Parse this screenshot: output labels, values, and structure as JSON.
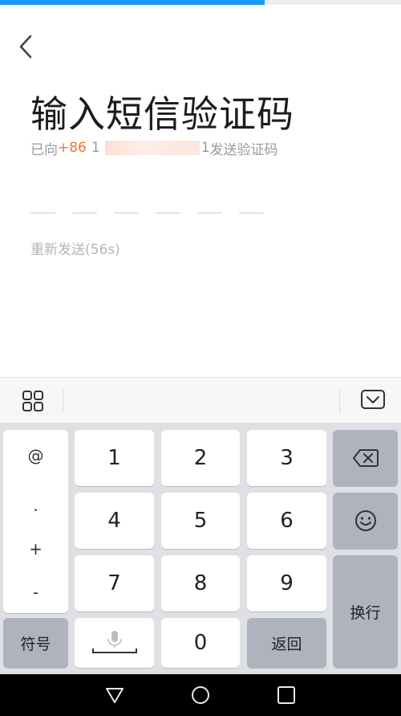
{
  "progress": {
    "fraction": 0.66,
    "color": "#1a9af2"
  },
  "header": {
    "back_icon": "chevron-left-icon"
  },
  "page": {
    "title": "输入短信验证码",
    "hint_prefix": "已向",
    "country_code": "+86",
    "phone_partial": "1",
    "phone_tail": "1",
    "hint_suffix": "发送验证码",
    "resend_label": "重新发送(56s)",
    "code_length": 6
  },
  "keyboard_toolbar": {
    "menu_icon": "grid-icon",
    "hide_icon": "keyboard-hide-icon"
  },
  "keyboard": {
    "symbols": [
      "@",
      ".",
      "+",
      "-"
    ],
    "digits": [
      "1",
      "2",
      "3",
      "4",
      "5",
      "6",
      "7",
      "8",
      "9",
      "0"
    ],
    "symbols_key": "符号",
    "return_key": "返回",
    "newline_key": "换行",
    "delete_icon": "backspace-icon",
    "emoji_icon": "smiley-icon",
    "voice_icon": "microphone-icon"
  },
  "navbar": {
    "back_icon": "triangle-back-icon",
    "home_icon": "circle-home-icon",
    "recents_icon": "square-recents-icon"
  },
  "colors": {
    "accent": "#f0743a",
    "key_gray": "#aeb3bd",
    "keyboard_bg": "#dfe0e4"
  }
}
